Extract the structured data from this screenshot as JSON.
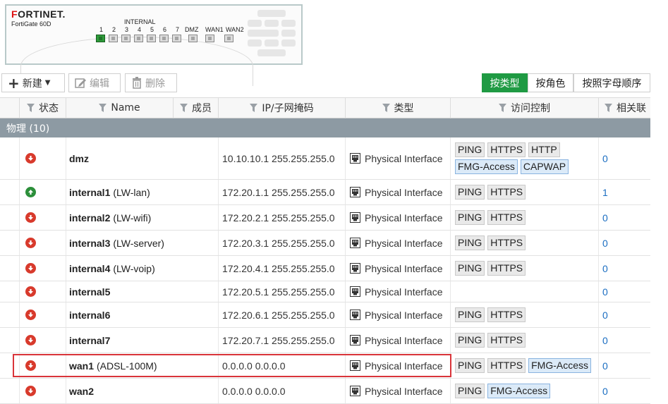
{
  "device": {
    "brand_prefix": "F",
    "brand_mark": "RTINET",
    "brand_o": "O",
    "model": "FortiGate 60D",
    "internal_label": "INTERNAL",
    "port_labels": [
      "1",
      "2",
      "3",
      "4",
      "5",
      "6",
      "7",
      "DMZ",
      "WAN1",
      "WAN2"
    ],
    "port_status": [
      "up",
      "down",
      "down",
      "down",
      "down",
      "down",
      "down",
      "down",
      "down",
      "down"
    ],
    "status_colors": {
      "up": "#2e9b3a",
      "down": "#dddddd"
    }
  },
  "toolbar": {
    "create_label": "新建",
    "edit_label": "编辑",
    "delete_label": "删除",
    "view_buttons": [
      {
        "label": "按类型",
        "active": true
      },
      {
        "label": "按角色",
        "active": false
      },
      {
        "label": "按照字母顺序",
        "active": false
      }
    ],
    "accent_color": "#1f9a43"
  },
  "table": {
    "headers": {
      "status": "状态",
      "name": "Name",
      "members": "成员",
      "ip": "IP/子网掩码",
      "type": "类型",
      "access": "访问控制",
      "ref": "相关联"
    },
    "group_label": "物理 (10)",
    "rows": [
      {
        "status": "down",
        "name": "dmz",
        "alias": "",
        "ip": "10.10.10.1 255.255.255.0",
        "type": "Physical Interface",
        "access": [
          [
            "PING",
            "gray"
          ],
          [
            "HTTPS",
            "gray"
          ],
          [
            "HTTP",
            "gray"
          ],
          [
            "FMG-Access",
            "blue"
          ],
          [
            "CAPWAP",
            "blue"
          ]
        ],
        "ref": "0"
      },
      {
        "status": "up",
        "name": "internal1",
        "alias": "(LW-lan)",
        "ip": "172.20.1.1 255.255.255.0",
        "type": "Physical Interface",
        "access": [
          [
            "PING",
            "gray"
          ],
          [
            "HTTPS",
            "gray"
          ]
        ],
        "ref": "1"
      },
      {
        "status": "down",
        "name": "internal2",
        "alias": "(LW-wifi)",
        "ip": "172.20.2.1 255.255.255.0",
        "type": "Physical Interface",
        "access": [
          [
            "PING",
            "gray"
          ],
          [
            "HTTPS",
            "gray"
          ]
        ],
        "ref": "0"
      },
      {
        "status": "down",
        "name": "internal3",
        "alias": "(LW-server)",
        "ip": "172.20.3.1 255.255.255.0",
        "type": "Physical Interface",
        "access": [
          [
            "PING",
            "gray"
          ],
          [
            "HTTPS",
            "gray"
          ]
        ],
        "ref": "0"
      },
      {
        "status": "down",
        "name": "internal4",
        "alias": "(LW-voip)",
        "ip": "172.20.4.1 255.255.255.0",
        "type": "Physical Interface",
        "access": [
          [
            "PING",
            "gray"
          ],
          [
            "HTTPS",
            "gray"
          ]
        ],
        "ref": "0"
      },
      {
        "status": "down",
        "name": "internal5",
        "alias": "",
        "ip": "172.20.5.1 255.255.255.0",
        "type": "Physical Interface",
        "access": [],
        "ref": "0"
      },
      {
        "status": "down",
        "name": "internal6",
        "alias": "",
        "ip": "172.20.6.1 255.255.255.0",
        "type": "Physical Interface",
        "access": [
          [
            "PING",
            "gray"
          ],
          [
            "HTTPS",
            "gray"
          ]
        ],
        "ref": "0"
      },
      {
        "status": "down",
        "name": "internal7",
        "alias": "",
        "ip": "172.20.7.1 255.255.255.0",
        "type": "Physical Interface",
        "access": [
          [
            "PING",
            "gray"
          ],
          [
            "HTTPS",
            "gray"
          ]
        ],
        "ref": "0"
      },
      {
        "status": "down",
        "name": "wan1",
        "alias": "(ADSL-100M)",
        "ip": "0.0.0.0 0.0.0.0",
        "type": "Physical Interface",
        "access": [
          [
            "PING",
            "gray"
          ],
          [
            "HTTPS",
            "gray"
          ],
          [
            "FMG-Access",
            "blue"
          ]
        ],
        "ref": "0"
      },
      {
        "status": "down",
        "name": "wan2",
        "alias": "",
        "ip": "0.0.0.0 0.0.0.0",
        "type": "Physical Interface",
        "access": [
          [
            "PING",
            "gray"
          ],
          [
            "FMG-Access",
            "blue"
          ]
        ],
        "ref": "0"
      }
    ],
    "highlighted_row": "wan1"
  }
}
